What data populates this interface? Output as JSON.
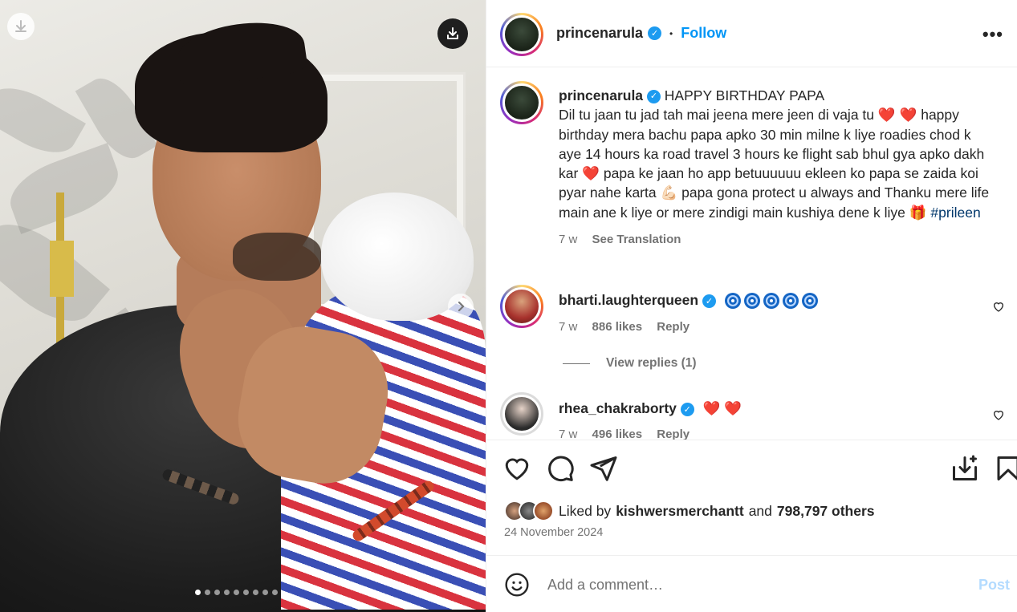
{
  "post": {
    "author": "princenarula",
    "follow_label": "Follow",
    "separator": "•",
    "more_label": "•••",
    "carousel": {
      "total_slides": 9,
      "active_index": 0
    }
  },
  "caption": {
    "username": "princenarula",
    "title": "HAPPY BIRTHDAY PAPA",
    "line1_a": "Dil tu jaan tu jad tah mai jeena mere jeen di vaja tu",
    "line1_b": "happy birthday mera bachu papa apko 30 min milne k liye roadies chod k aye 14 hours ka road travel 3 hours ke flight sab bhul gya apko dakh kar",
    "line1_c": "papa ke jaan ho app betuuuuuu ekleen ko papa se zaida koi pyar nahe karta",
    "line1_d": "papa gona protect u always and Thanku mere life main ane k liye or mere zindigi main kushiya dene k liye",
    "hashtag": "#prileen",
    "time": "7 w",
    "see_translation": "See Translation"
  },
  "comments": [
    {
      "username": "bharti.laughterqueen",
      "time": "7 w",
      "likes": "886 likes",
      "reply": "Reply"
    },
    {
      "username": "rhea_chakraborty",
      "time": "7 w",
      "likes": "496 likes",
      "reply": "Reply"
    }
  ],
  "view_replies": "View replies (1)",
  "liked": {
    "prefix": "Liked by",
    "user": "kishwersmerchantt",
    "and": "and",
    "count": "798,797 others"
  },
  "date": "24 November 2024",
  "add_comment": {
    "placeholder": "Add a comment…",
    "post_label": "Post"
  },
  "colors": {
    "accent": "#0095f6",
    "verified": "#1d9bf0",
    "heart": "#e0245e",
    "muted": "#737373"
  }
}
